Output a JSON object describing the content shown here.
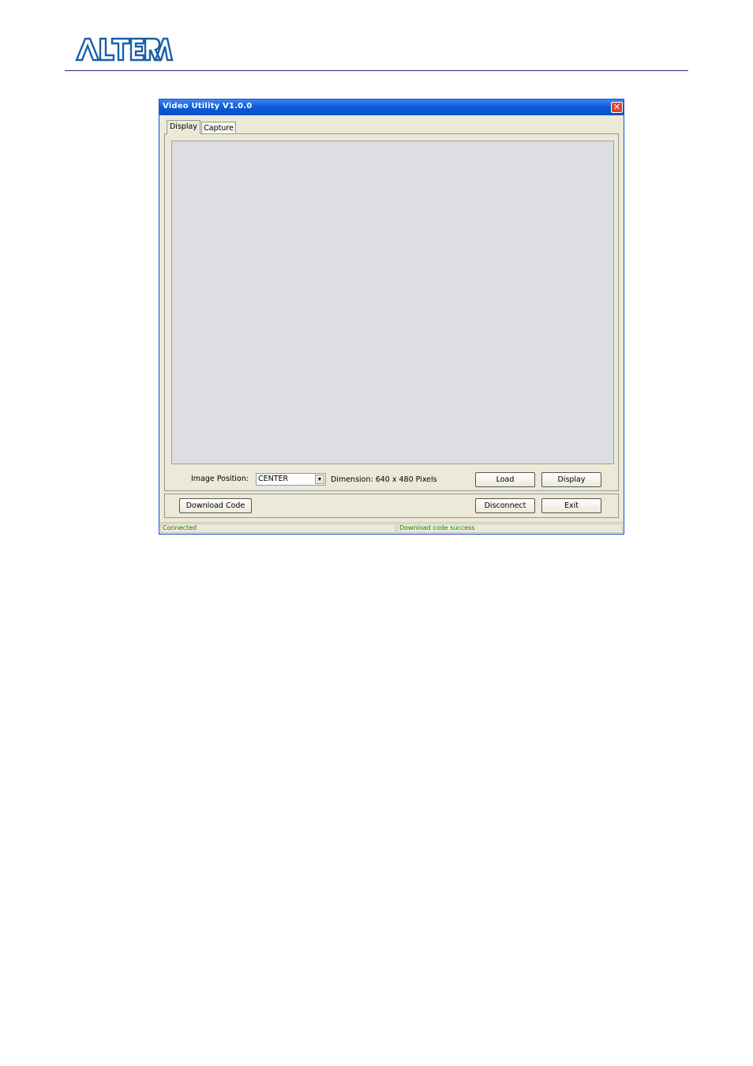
{
  "document": {
    "logo_text": "ALTERA",
    "colors": {
      "logo_blue": "#1a5fa8",
      "rule": "#2b2b8f"
    }
  },
  "window": {
    "title": "Video Utility V1.0.0",
    "close_symbol": "✕",
    "tabs": [
      {
        "label": "Display",
        "selected": true
      },
      {
        "label": "Capture",
        "selected": false
      }
    ],
    "display_tab": {
      "image_position_label": "Image Position:",
      "image_position_value": "CENTER",
      "dimension_text": "Dimension: 640 x 480 Pixels",
      "load_button": "Load",
      "display_button": "Display"
    },
    "bottom": {
      "download_code_button": "Download Code",
      "disconnect_button": "Disconnect",
      "exit_button": "Exit"
    },
    "statusbar": {
      "left": "Connected",
      "right": "Download code success"
    },
    "colors": {
      "titlebar": "#0a5ad8",
      "status_text": "#0a8a0a",
      "image_area": "#dcdee1"
    }
  }
}
